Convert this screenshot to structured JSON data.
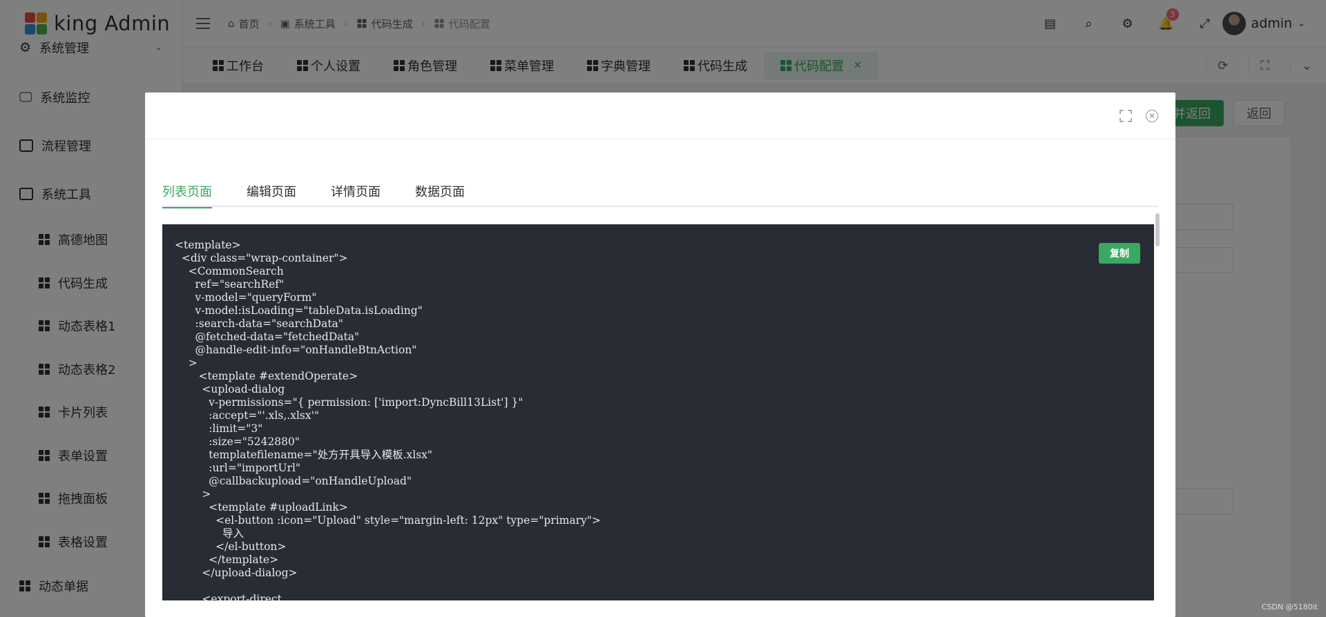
{
  "app": {
    "title": "king Admin"
  },
  "sidebar": {
    "top_item": "系统管理",
    "items": [
      {
        "label": "系统监控"
      },
      {
        "label": "流程管理"
      },
      {
        "label": "系统工具"
      }
    ],
    "sub_items": [
      {
        "label": "高德地图"
      },
      {
        "label": "代码生成"
      },
      {
        "label": "动态表格1"
      },
      {
        "label": "动态表格2"
      },
      {
        "label": "卡片列表"
      },
      {
        "label": "表单设置"
      },
      {
        "label": "拖拽面板"
      },
      {
        "label": "表格设置"
      }
    ],
    "bottom_item": "动态单据"
  },
  "breadcrumb": [
    {
      "label": "首页",
      "icon": "home-icon"
    },
    {
      "label": "系统工具",
      "icon": "tool-icon"
    },
    {
      "label": "代码生成",
      "icon": "grid-icon"
    },
    {
      "label": "代码配置",
      "icon": "grid-icon"
    }
  ],
  "header": {
    "notification_count": "3",
    "username": "admin"
  },
  "tags": [
    {
      "label": "工作台"
    },
    {
      "label": "个人设置"
    },
    {
      "label": "角色管理"
    },
    {
      "label": "菜单管理"
    },
    {
      "label": "字典管理"
    },
    {
      "label": "代码生成"
    },
    {
      "label": "代码配置",
      "active": true
    }
  ],
  "background": {
    "save_return_label": "并返回",
    "return_label": "返回"
  },
  "dialog": {
    "tabs": [
      "列表页面",
      "编辑页面",
      "详情页面",
      "数据页面"
    ],
    "copy_label": "复制",
    "code": "<template>\n  <div class=\"wrap-container\">\n    <CommonSearch\n      ref=\"searchRef\"\n      v-model=\"queryForm\"\n      v-model:isLoading=\"tableData.isLoading\"\n      :search-data=\"searchData\"\n      @fetched-data=\"fetchedData\"\n      @handle-edit-info=\"onHandleBtnAction\"\n    >\n       <template #extendOperate>\n        <upload-dialog\n          v-permissions=\"{ permission: ['import:DyncBill13List'] }\"\n          :accept=\"'.xls,.xlsx'\"\n          :limit=\"3\"\n          :size=\"5242880\"\n          templatefilename=\"处方开具导入模板.xlsx\"\n          :url=\"importUrl\"\n          @callbackupload=\"onHandleUpload\"\n        >\n          <template #uploadLink>\n            <el-button :icon=\"Upload\" style=\"margin-left: 12px\" type=\"primary\">\n              导入\n            </el-button>\n          </template>\n        </upload-dialog>\n\n        <export-direct"
  },
  "watermark": "CSDN @5180it",
  "colors": {
    "primary": "#3aa860",
    "code_bg": "#282c34",
    "badge": "#f56c6c"
  }
}
